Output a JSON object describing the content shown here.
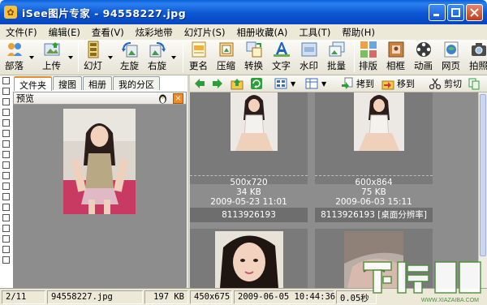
{
  "window": {
    "title": "iSee图片专家 - 94558227.jpg"
  },
  "menu": [
    "文件(F)",
    "编辑(E)",
    "查看(V)",
    "炫彩地带",
    "幻灯片(S)",
    "相册收藏(A)",
    "工具(T)",
    "帮助(H)"
  ],
  "toolbar": {
    "buttons": [
      {
        "label": "部落",
        "icon": "tribe-icon"
      },
      {
        "label": "上传",
        "icon": "upload-icon"
      },
      {
        "label": "幻灯",
        "icon": "slideshow-icon"
      },
      {
        "label": "左旋",
        "icon": "rotate-left-icon"
      },
      {
        "label": "右旋",
        "icon": "rotate-right-icon"
      },
      {
        "label": "更名",
        "icon": "rename-icon"
      },
      {
        "label": "压缩",
        "icon": "compress-icon"
      },
      {
        "label": "转换",
        "icon": "convert-icon"
      },
      {
        "label": "文字",
        "icon": "text-icon"
      },
      {
        "label": "水印",
        "icon": "watermark-icon"
      },
      {
        "label": "批量",
        "icon": "batch-icon"
      },
      {
        "label": "排版",
        "icon": "layout-icon"
      },
      {
        "label": "相框",
        "icon": "frame-icon"
      },
      {
        "label": "动画",
        "icon": "animation-icon"
      },
      {
        "label": "网页",
        "icon": "webpage-icon"
      },
      {
        "label": "拍照",
        "icon": "camera-icon"
      }
    ]
  },
  "left": {
    "tabs": [
      "文件夹",
      "搜图",
      "相册",
      "我的分区"
    ],
    "preview_title": "预览"
  },
  "nav2": {
    "copy_to": "拷到",
    "move_to": "移到",
    "cut": "剪切"
  },
  "thumbnails": [
    {
      "dims": "500x720",
      "size": "34 KB",
      "date": "2009-05-23 11:01",
      "caption": "8113926193"
    },
    {
      "dims": "600x864",
      "size": "75 KB",
      "date": "2009-06-03 15:11",
      "caption": "8113926193 [桌面分辨率]"
    },
    {
      "dims": "",
      "size": "",
      "date": "",
      "caption": ""
    },
    {
      "dims": "",
      "size": "",
      "date": "",
      "caption": ""
    }
  ],
  "status": {
    "index": "2/11",
    "filename": "94558227.jpg",
    "filesize": "197 KB",
    "dimensions": "450x675",
    "datetime": "2009-06-05 10:44:36",
    "time": "0.05秒"
  },
  "watermark": {
    "text": "下载吧",
    "url": "WWW.XIAZAIBA.COM"
  },
  "colors": {
    "titlebar": "#0a5fd8",
    "panel_bg": "#8d8d8d",
    "menu_bg": "#ece9d8"
  }
}
